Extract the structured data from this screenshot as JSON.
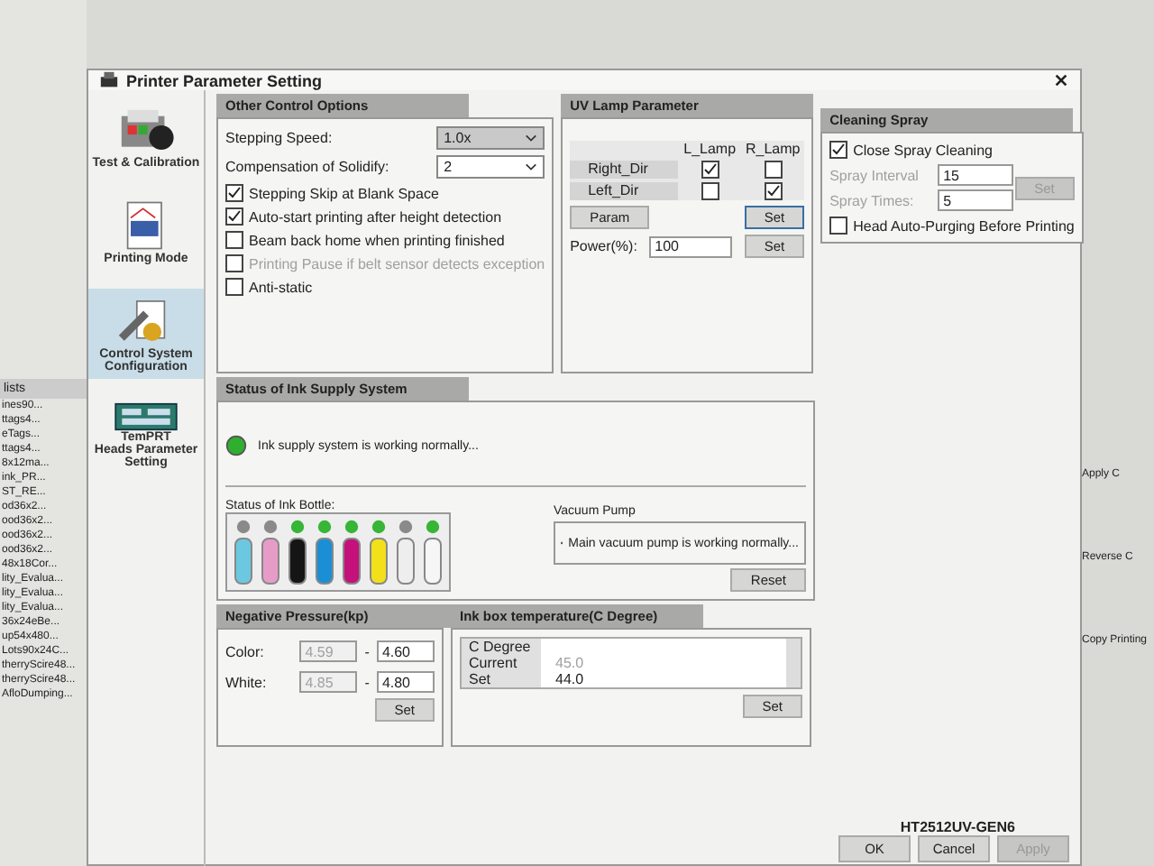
{
  "background_left": {
    "header": "lists",
    "items": [
      "ines90...",
      "ttags4...",
      "eTags...",
      "ttags4...",
      "8x12ma...",
      "ink_PR...",
      "ST_RE...",
      "od36x2...",
      "ood36x2...",
      "ood36x2...",
      "ood36x2...",
      "48x18Cor...",
      "lity_Evalua...",
      "lity_Evalua...",
      "lity_Evalua...",
      "36x24eBe...",
      "up54x480...",
      "Lots90x24C...",
      "therryScire48...",
      "therryScire48...",
      "AfloDumping..."
    ]
  },
  "background_right": {
    "items": [
      "Apply C",
      "Reverse C",
      "Copy Printing"
    ]
  },
  "window": {
    "title": "Printer Parameter Setting",
    "model": "HT2512UV-GEN6"
  },
  "sidebar": {
    "items": [
      {
        "kind": "calibration",
        "label": "Test & Calibration",
        "selected": false
      },
      {
        "kind": "mode",
        "label": "Printing Mode",
        "selected": false
      },
      {
        "kind": "config",
        "label": "Control System Configuration",
        "selected": true
      },
      {
        "kind": "heads",
        "label": "Heads Parameter Setting",
        "icon_text": "TemPRT",
        "selected": false
      }
    ]
  },
  "other_control_options": {
    "title": "Other Control Options",
    "dropdowns": [
      {
        "label": "Stepping Speed:",
        "value": "1.0x",
        "disabled": true
      },
      {
        "label": "Compensation of Solidify:",
        "value": "2",
        "disabled": false
      }
    ],
    "options": [
      {
        "label": "Stepping Skip at Blank Space",
        "checked": true,
        "disabled": false
      },
      {
        "label": "Auto-start printing after height detection",
        "checked": true,
        "disabled": false
      },
      {
        "label": "Beam back home when printing finished",
        "checked": false,
        "disabled": false
      },
      {
        "label": "Printing Pause if belt sensor detects exception",
        "checked": false,
        "disabled": true
      },
      {
        "label": "Anti-static",
        "checked": false,
        "disabled": false
      }
    ]
  },
  "uv_lamp": {
    "title": "UV Lamp Parameter",
    "columns": [
      "L_Lamp",
      "R_Lamp"
    ],
    "rows": [
      {
        "label": "Right_Dir",
        "l_lamp": true,
        "r_lamp": false
      },
      {
        "label": "Left_Dir",
        "l_lamp": false,
        "r_lamp": true
      }
    ],
    "param_button": "Param",
    "set_button": "Set",
    "power_label": "Power(%):",
    "power_value": "100",
    "power_set_button": "Set"
  },
  "cleaning_spray": {
    "title": "Cleaning Spray",
    "close_spray": {
      "label": "Close Spray Cleaning",
      "checked": true
    },
    "fields": [
      {
        "label": "Spray Interval",
        "value": "15"
      },
      {
        "label": "Spray Times:",
        "value": "5"
      }
    ],
    "set_button": "Set",
    "disabled": true,
    "auto_purge": {
      "label": "Head Auto-Purging Before Printing",
      "checked": false
    }
  },
  "ink_supply": {
    "title": "Status of Ink Supply System",
    "status_ok": true,
    "status_text": "Ink supply system is working normally...",
    "bottles_label": "Status of Ink Bottle:",
    "bottles": [
      {
        "color": "#6cc8e0",
        "on": false
      },
      {
        "color": "#e79cc8",
        "on": false
      },
      {
        "color": "#151515",
        "on": true
      },
      {
        "color": "#1b8fd6",
        "on": true
      },
      {
        "color": "#c4127a",
        "on": true
      },
      {
        "color": "#f1e01a",
        "on": true
      },
      {
        "color": "#eeeeee",
        "on": false
      },
      {
        "color": "#f6f6f6",
        "on": true
      }
    ],
    "vacuum_label": "Vacuum Pump",
    "vacuum_text": "Main vacuum pump is working normally...",
    "reset_button": "Reset"
  },
  "negative_pressure": {
    "title": "Negative Pressure(kp)",
    "rows": [
      {
        "label": "Color:",
        "current": "4.59",
        "separator": "-",
        "value": "4.60"
      },
      {
        "label": "White:",
        "current": "4.85",
        "separator": "-",
        "value": "4.80"
      }
    ],
    "set_button": "Set"
  },
  "ink_temperature": {
    "title": "Ink box temperature(C Degree)",
    "header": "C Degree",
    "rows": [
      {
        "label": "Current",
        "value": "45.0",
        "disabled": true
      },
      {
        "label": "Set",
        "value": "44.0",
        "disabled": false
      }
    ],
    "set_button": "Set"
  },
  "buttons": [
    {
      "label": "OK",
      "disabled": false
    },
    {
      "label": "Cancel",
      "disabled": false
    },
    {
      "label": "Apply",
      "disabled": true
    }
  ]
}
